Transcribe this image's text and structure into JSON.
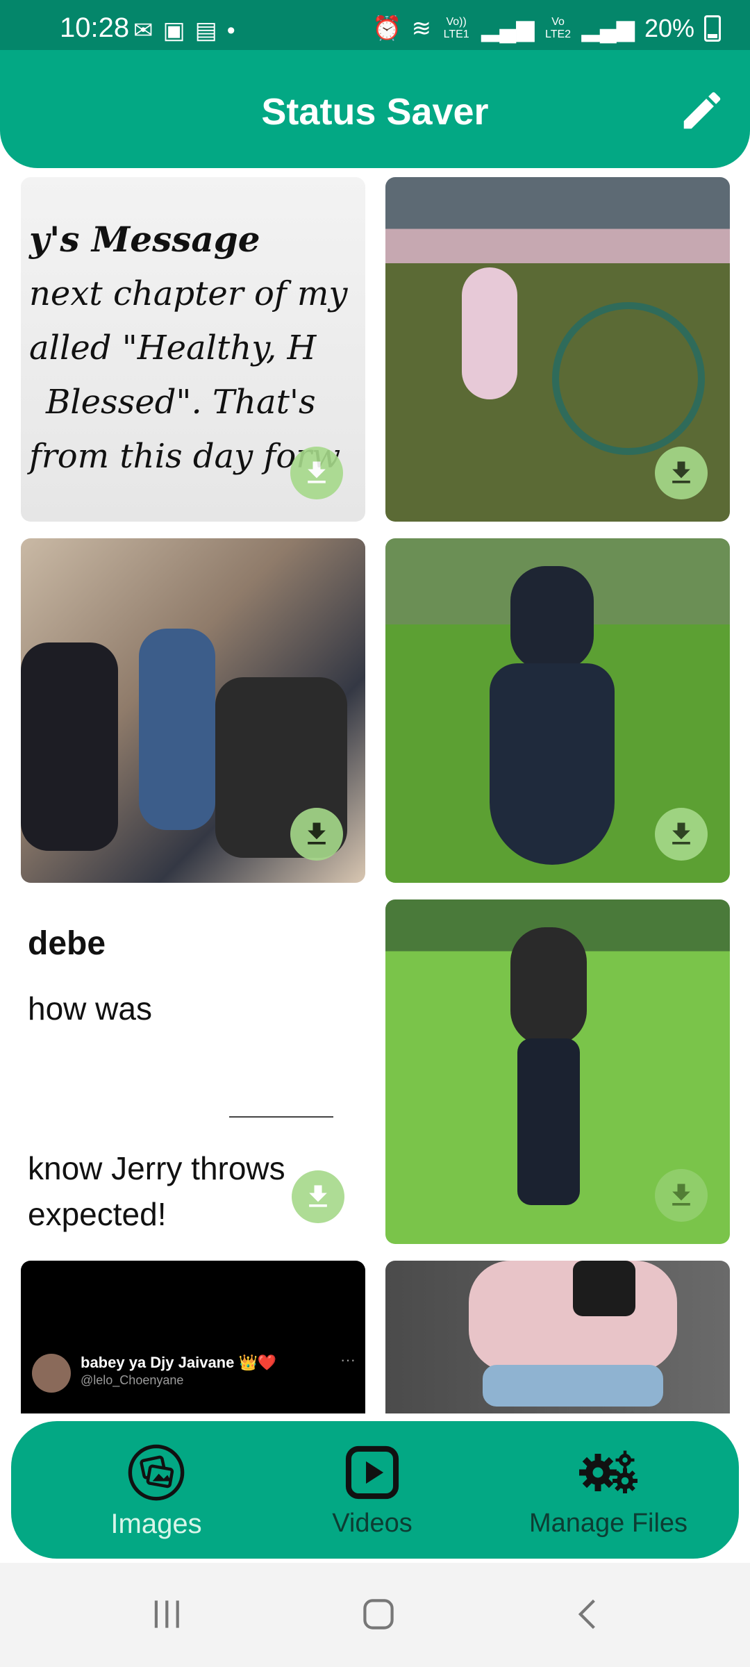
{
  "status_bar": {
    "time": "10:28",
    "left_icons": [
      "gmail-icon",
      "gallery-icon",
      "sim-icon",
      "dot-icon"
    ],
    "network_labels": [
      "Vo)) LTE1",
      "Vo LTE2"
    ],
    "battery": "20%"
  },
  "app_bar": {
    "title": "Status Saver",
    "action_icon": "edit-icon"
  },
  "grid": {
    "tiles": [
      {
        "kind": "text-image",
        "lines": [
          "y's Message",
          "next chapter of my",
          "alled \"Healthy, H",
          "Blessed\". That's",
          "from this day forw"
        ],
        "download_icon": "download-icon"
      },
      {
        "kind": "photo",
        "description": "person watering lawn with hose",
        "download_icon": "download-icon"
      },
      {
        "kind": "photo",
        "description": "group of people seated outdoors",
        "download_icon": "download-icon"
      },
      {
        "kind": "photo",
        "description": "woman in black gown on lawn",
        "download_icon": "download-icon"
      },
      {
        "kind": "text-image",
        "lines": [
          "debe",
          "how was",
          "know Jerry throws",
          "expected!"
        ],
        "download_icon": "download-icon"
      },
      {
        "kind": "photo",
        "description": "woman standing in sunny garden",
        "download_icon": "download-icon"
      },
      {
        "kind": "post",
        "name": "babey ya Djy Jaivane 👑❤️",
        "handle": "@lelo_Choenyane",
        "more": "···"
      },
      {
        "kind": "photo",
        "description": "child holding a phone"
      }
    ]
  },
  "bottom_nav": {
    "items": [
      {
        "label": "Images",
        "icon": "images-icon",
        "active": true
      },
      {
        "label": "Videos",
        "icon": "videos-icon",
        "active": false
      },
      {
        "label": "Manage Files",
        "icon": "settings-gears-icon",
        "active": false
      }
    ]
  },
  "system_nav": {
    "buttons": [
      "recents-icon",
      "home-icon",
      "back-icon"
    ]
  },
  "colors": {
    "status_bar": "#04866a",
    "primary": "#03a884",
    "download_button": "#a6d98a",
    "nav_inactive_label": "#0d3d33",
    "nav_active_label": "#d8f5e9"
  }
}
